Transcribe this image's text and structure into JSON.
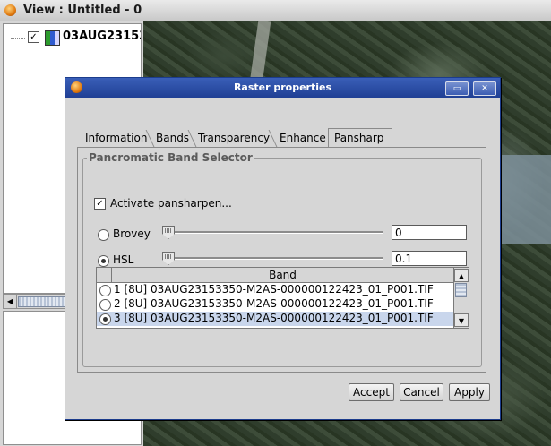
{
  "view_window": {
    "title": "View : Untitled - 0",
    "layer_name": "03AUG23153"
  },
  "dialog": {
    "title": "Raster properties",
    "tabs": [
      {
        "label": "Information"
      },
      {
        "label": "Bands"
      },
      {
        "label": "Transparency"
      },
      {
        "label": "Enhance"
      },
      {
        "label": "Pansharp"
      }
    ],
    "active_tab": "Pansharp",
    "group_title": "Pancromatic Band Selector",
    "activate_label": "Activate pansharpen...",
    "activate_checked": true,
    "brovey": {
      "label": "Brovey",
      "selected": false,
      "value": "0"
    },
    "hsl": {
      "label": "HSL",
      "selected": true,
      "value": "0.1"
    },
    "band_table": {
      "header": "Band",
      "rows": [
        {
          "label": "1 [8U] 03AUG23153350-M2AS-000000122423_01_P001.TIF",
          "selected": false
        },
        {
          "label": "2 [8U] 03AUG23153350-M2AS-000000122423_01_P001.TIF",
          "selected": false
        },
        {
          "label": "3 [8U] 03AUG23153350-M2AS-000000122423_01_P001.TIF",
          "selected": true
        }
      ]
    },
    "buttons": {
      "accept": "Accept",
      "cancel": "Cancel",
      "apply": "Apply"
    }
  },
  "icons": [
    "gvsig-icon",
    "checkbox-icon",
    "raster-layer-icon",
    "maximize-icon",
    "close-icon",
    "scroll-left-icon",
    "scroll-up-icon",
    "scroll-down-icon"
  ]
}
